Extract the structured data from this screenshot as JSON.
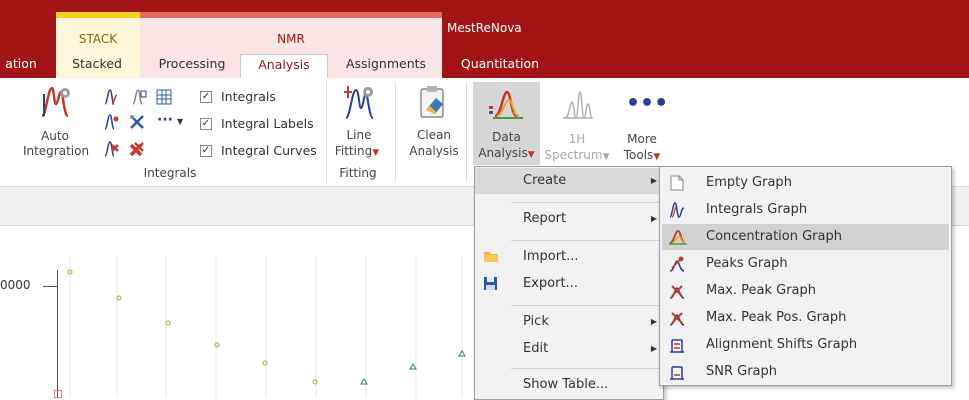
{
  "app": {
    "title": "MestReNova"
  },
  "context_tabs": {
    "stack": "STACK",
    "nmr": "NMR"
  },
  "tabs": [
    {
      "label": "ation"
    },
    {
      "label": "Stacked"
    },
    {
      "label": "Processing"
    },
    {
      "label": "Analysis",
      "active": true
    },
    {
      "label": "Assignments"
    },
    {
      "label": "Quantitation"
    }
  ],
  "ribbon": {
    "auto_integration": {
      "line1": "Auto",
      "line2": "Integration"
    },
    "checks": [
      {
        "label": "Integrals",
        "checked": true
      },
      {
        "label": "Integral Labels",
        "checked": true
      },
      {
        "label": "Integral Curves",
        "checked": true
      }
    ],
    "group_integrals": "Integrals",
    "line_fitting": {
      "line1": "Line",
      "line2": "Fitting"
    },
    "group_fitting": "Fitting",
    "clean_analysis": {
      "line1": "Clean",
      "line2": "Analysis"
    },
    "data_analysis": {
      "line1": "Data",
      "line2": "Analysis"
    },
    "h1_spectrum": {
      "line1": "1H",
      "line2": "Spectrum"
    },
    "more_tools": {
      "line1": "More",
      "line2": "Tools"
    }
  },
  "plot": {
    "y_tick": "0000"
  },
  "menu": {
    "items": [
      {
        "label": "Create",
        "submenu": true
      },
      {
        "label": "Report",
        "submenu": true
      },
      {
        "label": "Import..."
      },
      {
        "label": "Export..."
      },
      {
        "label": "Pick",
        "submenu": true
      },
      {
        "label": "Edit",
        "submenu": true
      },
      {
        "label": "Show Table..."
      }
    ]
  },
  "submenu": {
    "items": [
      {
        "label": "Empty Graph"
      },
      {
        "label": "Integrals Graph"
      },
      {
        "label": "Concentration Graph",
        "highlighted": true
      },
      {
        "label": "Peaks Graph"
      },
      {
        "label": "Max. Peak Graph"
      },
      {
        "label": "Max. Peak Pos. Graph"
      },
      {
        "label": "Alignment Shifts Graph"
      },
      {
        "label": "SNR Graph"
      }
    ]
  },
  "colors": {
    "brand": "#a31515",
    "stack": "#f4d21f",
    "nmr": "#e36a6a"
  }
}
